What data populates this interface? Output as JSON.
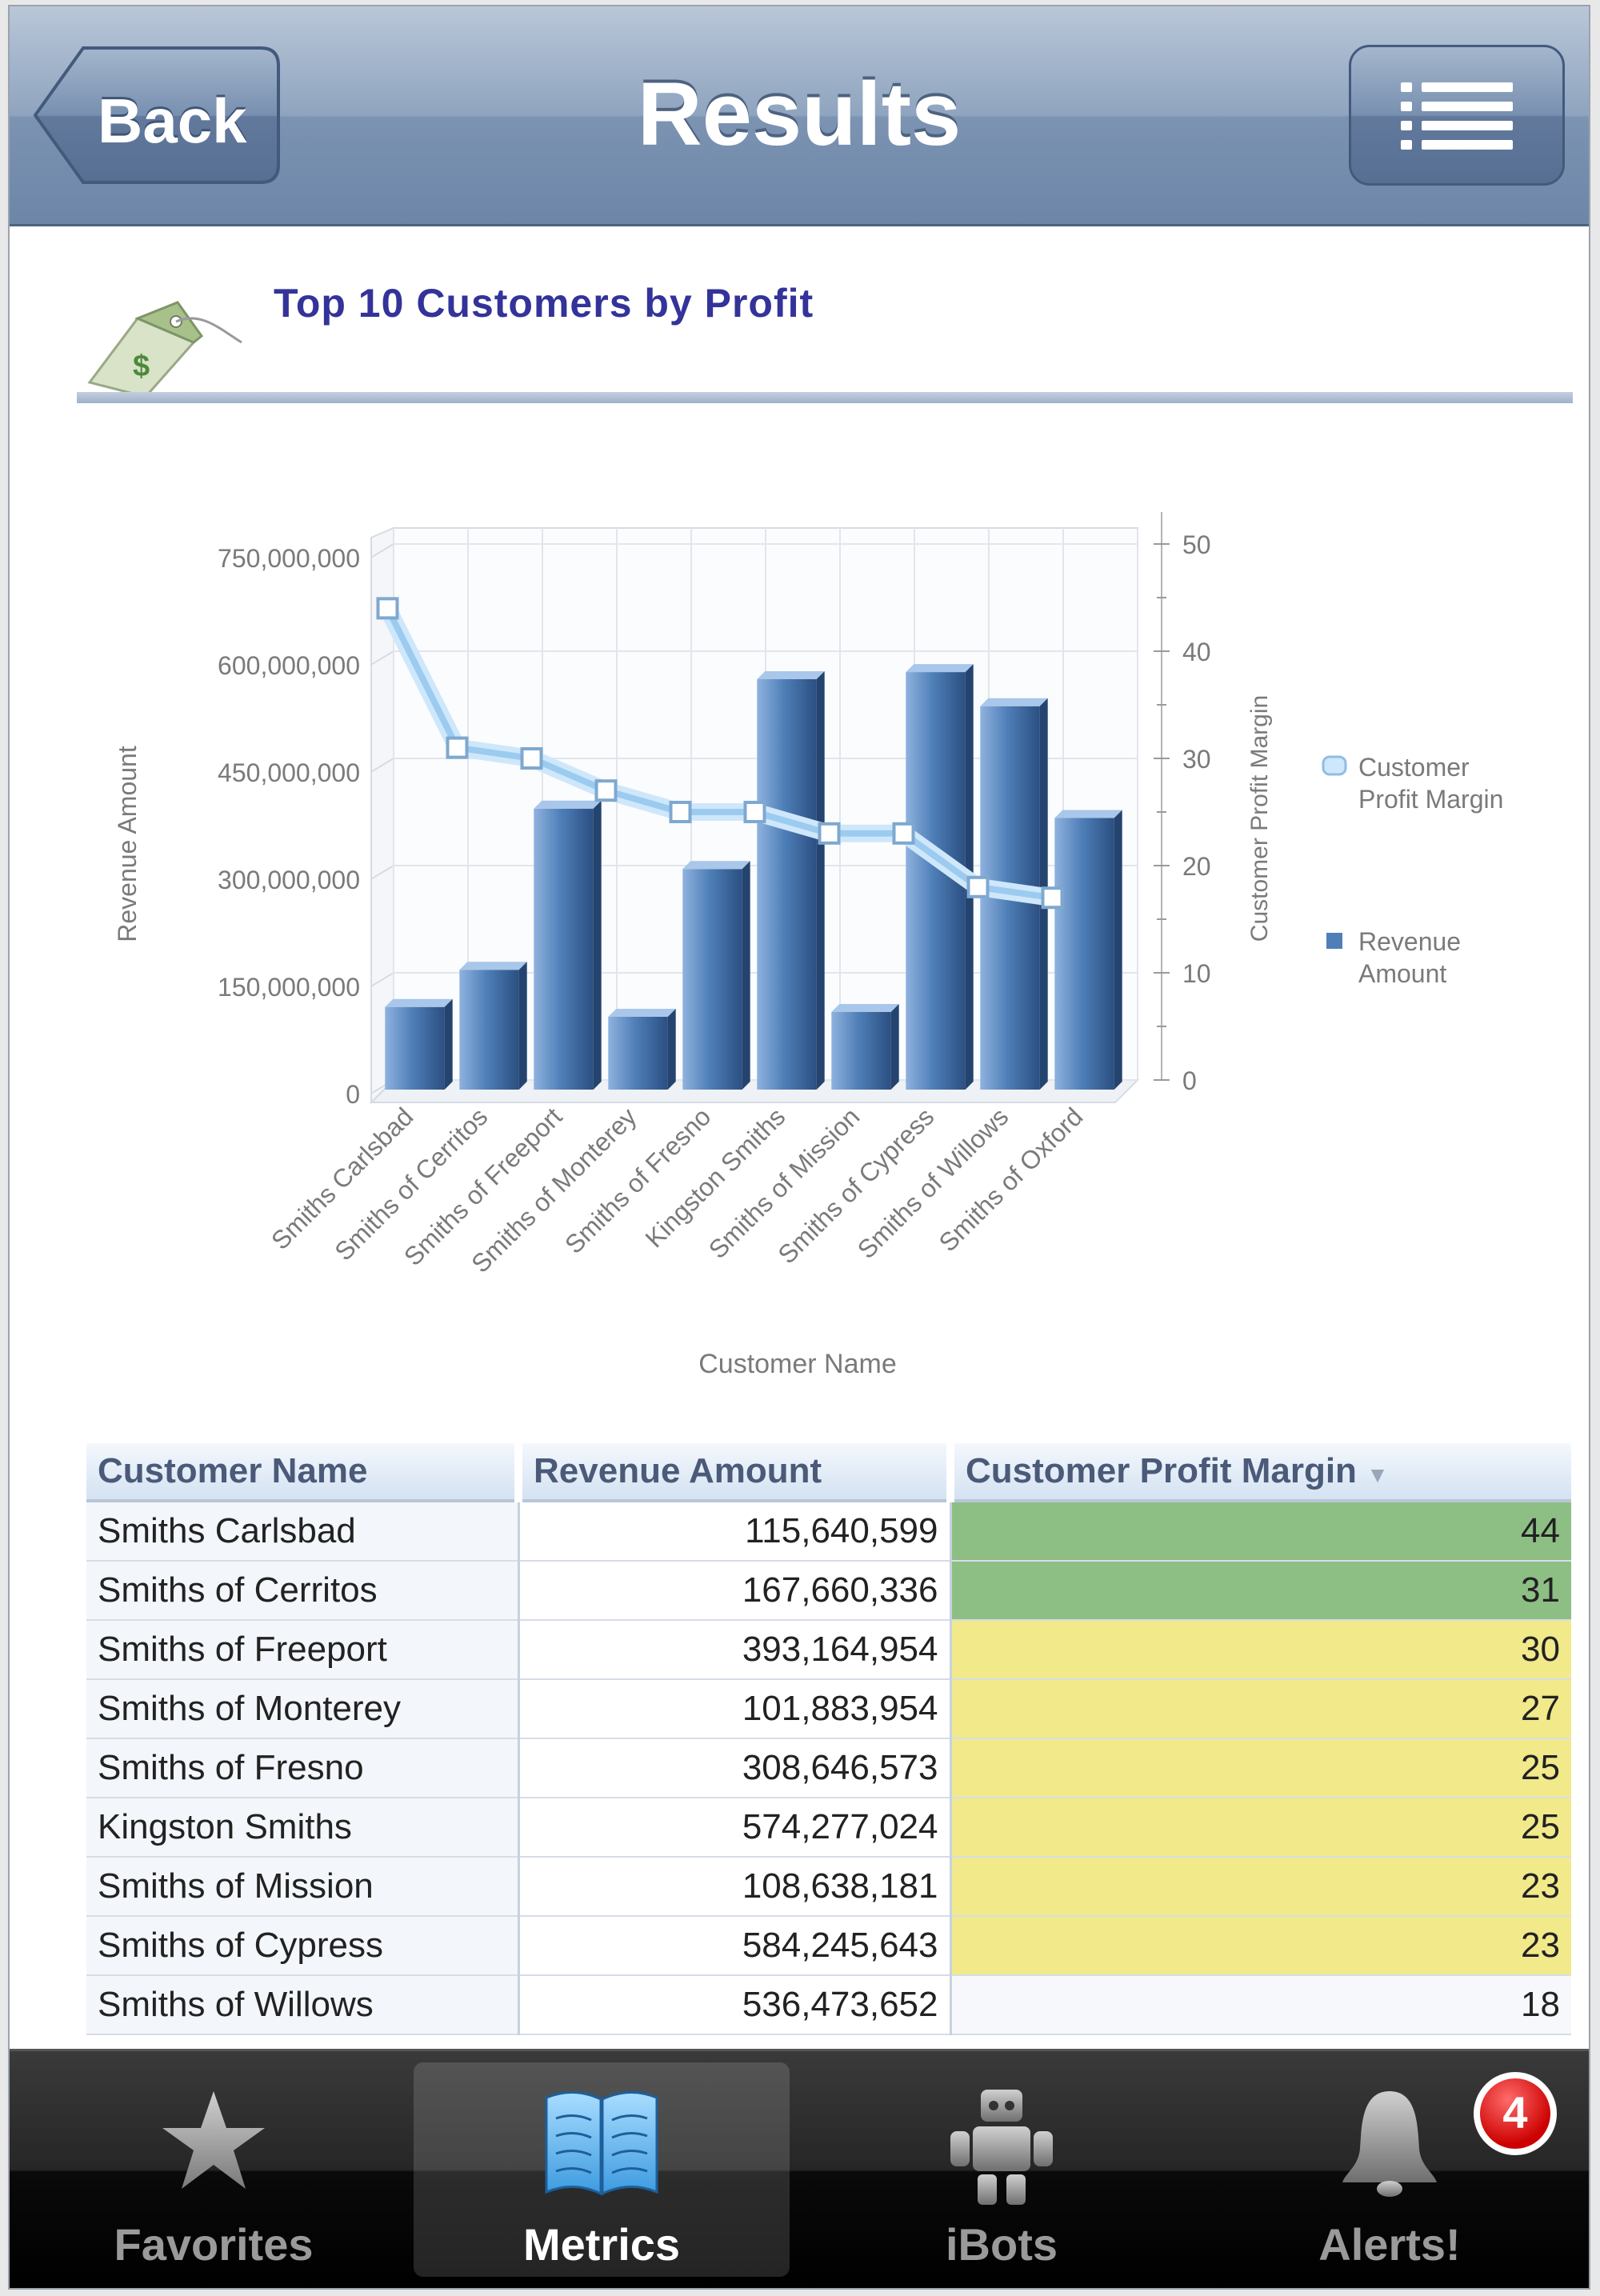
{
  "nav": {
    "title": "Results",
    "back_label": "Back"
  },
  "report": {
    "title": "Top 10 Customers by Profit"
  },
  "chart_data": {
    "type": "bar",
    "xlabel": "Customer Name",
    "ylabel": "Revenue Amount",
    "y2label": "Customer Profit Margin",
    "ylim": [
      0,
      750000000
    ],
    "y2lim": [
      0,
      50
    ],
    "yticks": [
      "0",
      "150,000,000",
      "300,000,000",
      "450,000,000",
      "600,000,000",
      "750,000,000"
    ],
    "y2ticks": [
      "0",
      "10",
      "20",
      "30",
      "40",
      "50"
    ],
    "legend_position": "right",
    "grid": true,
    "categories": [
      "Smiths Carlsbad",
      "Smiths of Cerritos",
      "Smiths of Freeport",
      "Smiths of Monterey",
      "Smiths of Fresno",
      "Kingston Smiths",
      "Smiths of Mission",
      "Smiths of Cypress",
      "Smiths of Willows",
      "Smiths of Oxford"
    ],
    "series": [
      {
        "name": "Revenue Amount",
        "type": "bar",
        "axis": "left",
        "legend_label": [
          "Revenue",
          "Amount"
        ],
        "values": [
          115640599,
          167660336,
          393164954,
          101883954,
          308646573,
          574277024,
          108638181,
          584245643,
          536473652,
          380000000
        ]
      },
      {
        "name": "Customer Profit Margin",
        "type": "line",
        "axis": "right",
        "legend_label": [
          "Customer",
          "Profit Margin"
        ],
        "values": [
          44,
          31,
          30,
          27,
          25,
          25,
          23,
          23,
          18,
          17
        ]
      }
    ],
    "colors": {
      "bar": "#4f7fb8",
      "line": "#a9d3f2"
    }
  },
  "table": {
    "headers": [
      "Customer Name",
      "Revenue Amount",
      "Customer Profit Margin"
    ],
    "sort_indicator": "▼",
    "rows": [
      {
        "name": "Smiths Carlsbad",
        "revenue": "115,640,599",
        "margin": "44",
        "status": "green"
      },
      {
        "name": "Smiths of Cerritos",
        "revenue": "167,660,336",
        "margin": "31",
        "status": "green"
      },
      {
        "name": "Smiths of Freeport",
        "revenue": "393,164,954",
        "margin": "30",
        "status": "yellow"
      },
      {
        "name": "Smiths of Monterey",
        "revenue": "101,883,954",
        "margin": "27",
        "status": "yellow"
      },
      {
        "name": "Smiths of Fresno",
        "revenue": "308,646,573",
        "margin": "25",
        "status": "yellow"
      },
      {
        "name": "Kingston Smiths",
        "revenue": "574,277,024",
        "margin": "25",
        "status": "yellow"
      },
      {
        "name": "Smiths of Mission",
        "revenue": "108,638,181",
        "margin": "23",
        "status": "yellow"
      },
      {
        "name": "Smiths of Cypress",
        "revenue": "584,245,643",
        "margin": "23",
        "status": "yellow"
      },
      {
        "name": "Smiths of Willows",
        "revenue": "536,473,652",
        "margin": "18",
        "status": "plain"
      }
    ],
    "status_colors": {
      "green": "#8dbf85",
      "yellow": "#f1e98a"
    }
  },
  "tabbar": {
    "tabs": [
      {
        "label": "Favorites",
        "icon": "star-icon"
      },
      {
        "label": "Metrics",
        "icon": "book-icon",
        "active": true
      },
      {
        "label": "iBots",
        "icon": "robot-icon"
      },
      {
        "label": "Alerts!",
        "icon": "bell-icon",
        "badge": "4"
      }
    ]
  }
}
